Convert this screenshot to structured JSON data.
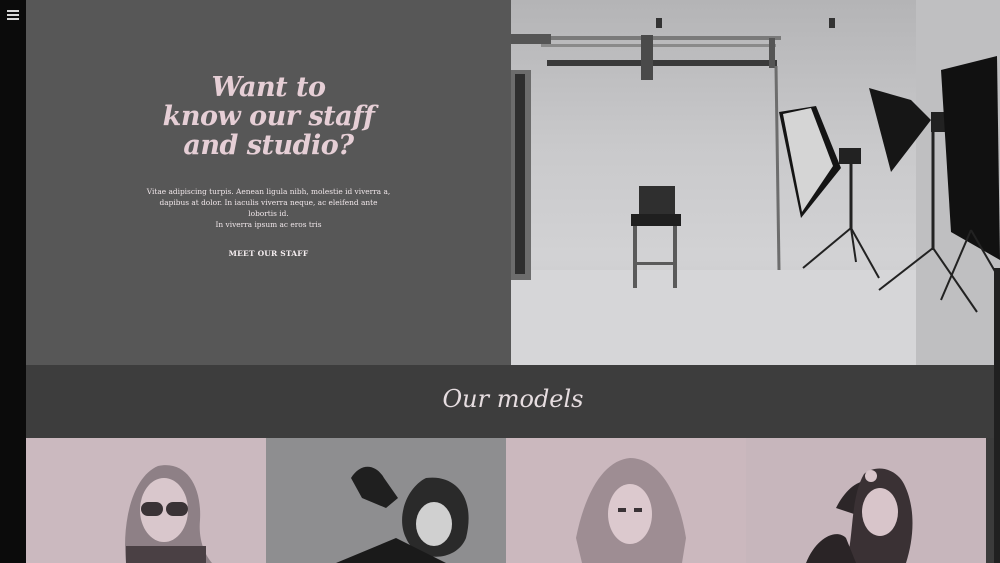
{
  "hero": {
    "title_lines": [
      "Want to",
      "know our staff",
      "and studio?"
    ],
    "description_lines": [
      "Vitae adipiscing turpis. Aenean ligula nibh, molestie id viverra a,",
      "dapibus at dolor. In iaculis viverra neque, ac eleifend ante lobortis id.",
      "In viverra ipsum ac eros tris"
    ],
    "cta_label": "MEET OUR STAFF"
  },
  "models_section": {
    "title": "Our models"
  },
  "colors": {
    "sidebar": "#0b0b0b",
    "hero_panel": "#575757",
    "title_pink": "#e6cfd6",
    "band": "#3d3d3d",
    "tile_pink": "#c9b7bd",
    "tile_gray": "#9b9b9b"
  },
  "icons": {
    "menu": "hamburger-icon"
  }
}
